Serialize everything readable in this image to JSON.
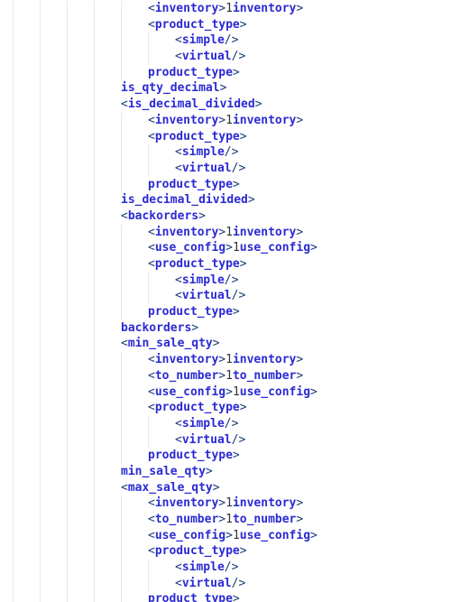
{
  "gutter_numbers": [
    "",
    "",
    "",
    "",
    "",
    "",
    "",
    "",
    "",
    "",
    "",
    "",
    "",
    "",
    "",
    "",
    "",
    "",
    "",
    "",
    "",
    "",
    "",
    "",
    "",
    "",
    "",
    "",
    "",
    "",
    "",
    "",
    "",
    "",
    "",
    "",
    "",
    ""
  ],
  "tokens": {
    "open_lt": "<",
    "open_lt_slash": "</",
    "gt": ">",
    "selfclose": "/>"
  },
  "xml_lines": [
    {
      "indent": 5,
      "type": "elem",
      "tag": "inventory",
      "value": "1"
    },
    {
      "indent": 5,
      "type": "open",
      "tag": "product_type"
    },
    {
      "indent": 6,
      "type": "self",
      "tag": "simple"
    },
    {
      "indent": 6,
      "type": "self",
      "tag": "virtual"
    },
    {
      "indent": 5,
      "type": "close",
      "tag": "product_type"
    },
    {
      "indent": 4,
      "type": "close",
      "tag": "is_qty_decimal"
    },
    {
      "indent": 4,
      "type": "open",
      "tag": "is_decimal_divided"
    },
    {
      "indent": 5,
      "type": "elem",
      "tag": "inventory",
      "value": "1"
    },
    {
      "indent": 5,
      "type": "open",
      "tag": "product_type"
    },
    {
      "indent": 6,
      "type": "self",
      "tag": "simple"
    },
    {
      "indent": 6,
      "type": "self",
      "tag": "virtual"
    },
    {
      "indent": 5,
      "type": "close",
      "tag": "product_type"
    },
    {
      "indent": 4,
      "type": "close",
      "tag": "is_decimal_divided"
    },
    {
      "indent": 4,
      "type": "open",
      "tag": "backorders"
    },
    {
      "indent": 5,
      "type": "elem",
      "tag": "inventory",
      "value": "1"
    },
    {
      "indent": 5,
      "type": "elem",
      "tag": "use_config",
      "value": "1"
    },
    {
      "indent": 5,
      "type": "open",
      "tag": "product_type"
    },
    {
      "indent": 6,
      "type": "self",
      "tag": "simple"
    },
    {
      "indent": 6,
      "type": "self",
      "tag": "virtual"
    },
    {
      "indent": 5,
      "type": "close",
      "tag": "product_type"
    },
    {
      "indent": 4,
      "type": "close",
      "tag": "backorders"
    },
    {
      "indent": 4,
      "type": "open",
      "tag": "min_sale_qty"
    },
    {
      "indent": 5,
      "type": "elem",
      "tag": "inventory",
      "value": "1"
    },
    {
      "indent": 5,
      "type": "elem",
      "tag": "to_number",
      "value": "1"
    },
    {
      "indent": 5,
      "type": "elem",
      "tag": "use_config",
      "value": "1"
    },
    {
      "indent": 5,
      "type": "open",
      "tag": "product_type"
    },
    {
      "indent": 6,
      "type": "self",
      "tag": "simple"
    },
    {
      "indent": 6,
      "type": "self",
      "tag": "virtual"
    },
    {
      "indent": 5,
      "type": "close",
      "tag": "product_type"
    },
    {
      "indent": 4,
      "type": "close",
      "tag": "min_sale_qty"
    },
    {
      "indent": 4,
      "type": "open",
      "tag": "max_sale_qty"
    },
    {
      "indent": 5,
      "type": "elem",
      "tag": "inventory",
      "value": "1"
    },
    {
      "indent": 5,
      "type": "elem",
      "tag": "to_number",
      "value": "1"
    },
    {
      "indent": 5,
      "type": "elem",
      "tag": "use_config",
      "value": "1"
    },
    {
      "indent": 5,
      "type": "open",
      "tag": "product_type"
    },
    {
      "indent": 6,
      "type": "self",
      "tag": "simple"
    },
    {
      "indent": 6,
      "type": "self",
      "tag": "virtual"
    },
    {
      "indent": 5,
      "type": "close",
      "tag": "product_type"
    }
  ]
}
